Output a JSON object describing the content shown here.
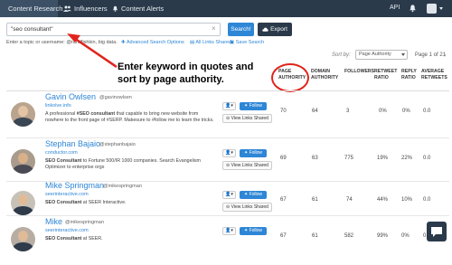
{
  "nav": {
    "tabs": [
      {
        "label": "Content Research",
        "icon": "search-icon"
      },
      {
        "label": "Influencers",
        "icon": "users-icon"
      },
      {
        "label": "Content Alerts",
        "icon": "bell-icon"
      }
    ],
    "api_label": "API"
  },
  "search": {
    "value": "\"seo consultant\"",
    "button_label": "Search!",
    "export_label": "Export",
    "hint_text": "Enter a topic or username: @randfishkin, big data.",
    "advanced_label": "Advanced Search Options",
    "all_links_label": "All Links Shared",
    "save_label": "Save Search"
  },
  "annotation": "Enter keyword in quotes and sort by page authority.",
  "sort": {
    "label": "Sort by:",
    "selected": "Page Authority",
    "pager": "Page 1 of 21"
  },
  "columns": {
    "page_authority": "PAGE AUTHORITY",
    "domain_authority": "DOMAIN AUTHORITY",
    "followers": "FOLLOWERS",
    "retweet_ratio": "RETWEET RATIO",
    "reply_ratio": "REPLY RATIO",
    "average_retweets": "AVERAGE RETWEETS"
  },
  "buttons": {
    "follow": "Follow",
    "links": "View Links Shared"
  },
  "rows": [
    {
      "name": "Gavin Owlsen",
      "handle": "@gavinowlsen",
      "site": "linkolve.info",
      "bio_pre": "A professional ",
      "bio_bold": "#SEO consultant",
      "bio_post": " that capable to bring new website from nowhere to the front page of #SERP. Makesure to #follow me to learn the tricks.",
      "page_authority": "70",
      "domain_authority": "64",
      "followers": "3",
      "retweet_ratio": "0%",
      "reply_ratio": "0%",
      "average_retweets": "0.0"
    },
    {
      "name": "Stephan Bajaio",
      "handle": "@stephanbajaio",
      "site": "conductor.com",
      "bio_pre": "",
      "bio_bold": "SEO Consultant",
      "bio_post": " to Fortune 500/IR 1000 companies. Search Evangelism Optimizer to enterprise orgs",
      "page_authority": "69",
      "domain_authority": "63",
      "followers": "775",
      "retweet_ratio": "19%",
      "reply_ratio": "22%",
      "average_retweets": "0.0"
    },
    {
      "name": "Mike Springman",
      "handle": "@mikespringman",
      "site": "seerinteractive.com",
      "bio_pre": "",
      "bio_bold": "SEO Consultant",
      "bio_post": " at SEER Interactive.",
      "page_authority": "67",
      "domain_authority": "61",
      "followers": "74",
      "retweet_ratio": "44%",
      "reply_ratio": "10%",
      "average_retweets": "0.0"
    },
    {
      "name": "Mike",
      "handle": "@mikespringman",
      "site": "seerinteractive.com",
      "bio_pre": "",
      "bio_bold": "SEO Consultant",
      "bio_post": " at SEER.",
      "page_authority": "67",
      "domain_authority": "61",
      "followers": "582",
      "retweet_ratio": "99%",
      "reply_ratio": "0%",
      "average_retweets": "0.0"
    }
  ],
  "colors": {
    "nav_bg": "#2b3a4a",
    "accent": "#2e86d6",
    "annotation_circle": "#e0241d"
  }
}
